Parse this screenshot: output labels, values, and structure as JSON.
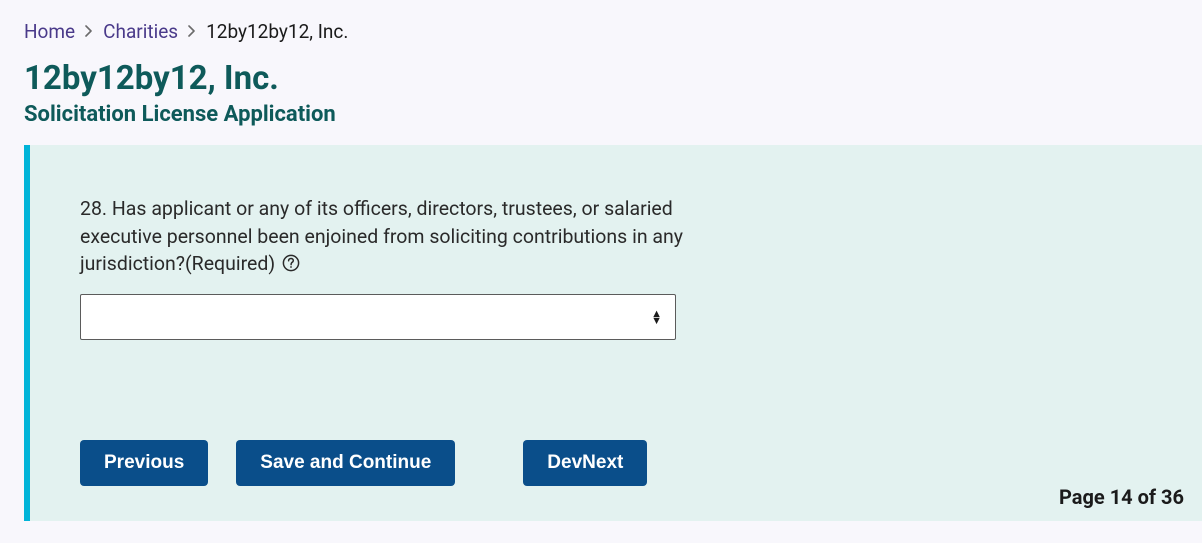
{
  "breadcrumb": {
    "home": "Home",
    "charities": "Charities",
    "current": "12by12by12, Inc."
  },
  "header": {
    "title": "12by12by12, Inc.",
    "subtitle": "Solicitation License Application"
  },
  "question": {
    "label": "28. Has applicant or any of its officers, directors, trustees, or salaried executive personnel been enjoined from soliciting contributions in any jurisdiction?(Required)",
    "value": ""
  },
  "buttons": {
    "previous": "Previous",
    "save_continue": "Save and Continue",
    "devnext": "DevNext"
  },
  "pager": {
    "text": "Page 14 of 36"
  }
}
